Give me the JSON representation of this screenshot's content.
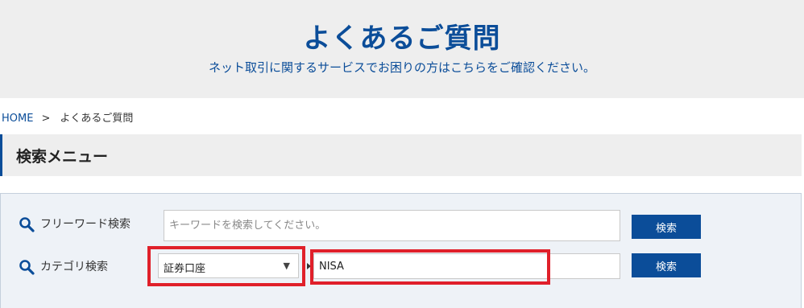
{
  "hero": {
    "title": "よくあるご質問",
    "subtitle": "ネット取引に関するサービスでお困りの方はこちらをご確認ください。"
  },
  "breadcrumb": {
    "home": "HOME",
    "separator": ">",
    "current": "よくあるご質問"
  },
  "section": {
    "title": "検索メニュー"
  },
  "search": {
    "freeword": {
      "label": "フリーワード検索",
      "icon": "search-icon",
      "placeholder": "キーワードを検索してください。",
      "value": "",
      "button_label": "検索"
    },
    "category": {
      "label": "カテゴリ検索",
      "icon": "search-icon",
      "selected": "証券口座",
      "arrow": "▼",
      "input_value": "NISA",
      "button_label": "検索"
    }
  },
  "colors": {
    "brand": "#0b4d99",
    "highlight": "#e0202a",
    "panel": "#eef2f7",
    "hero_bg": "#eeeeee"
  }
}
